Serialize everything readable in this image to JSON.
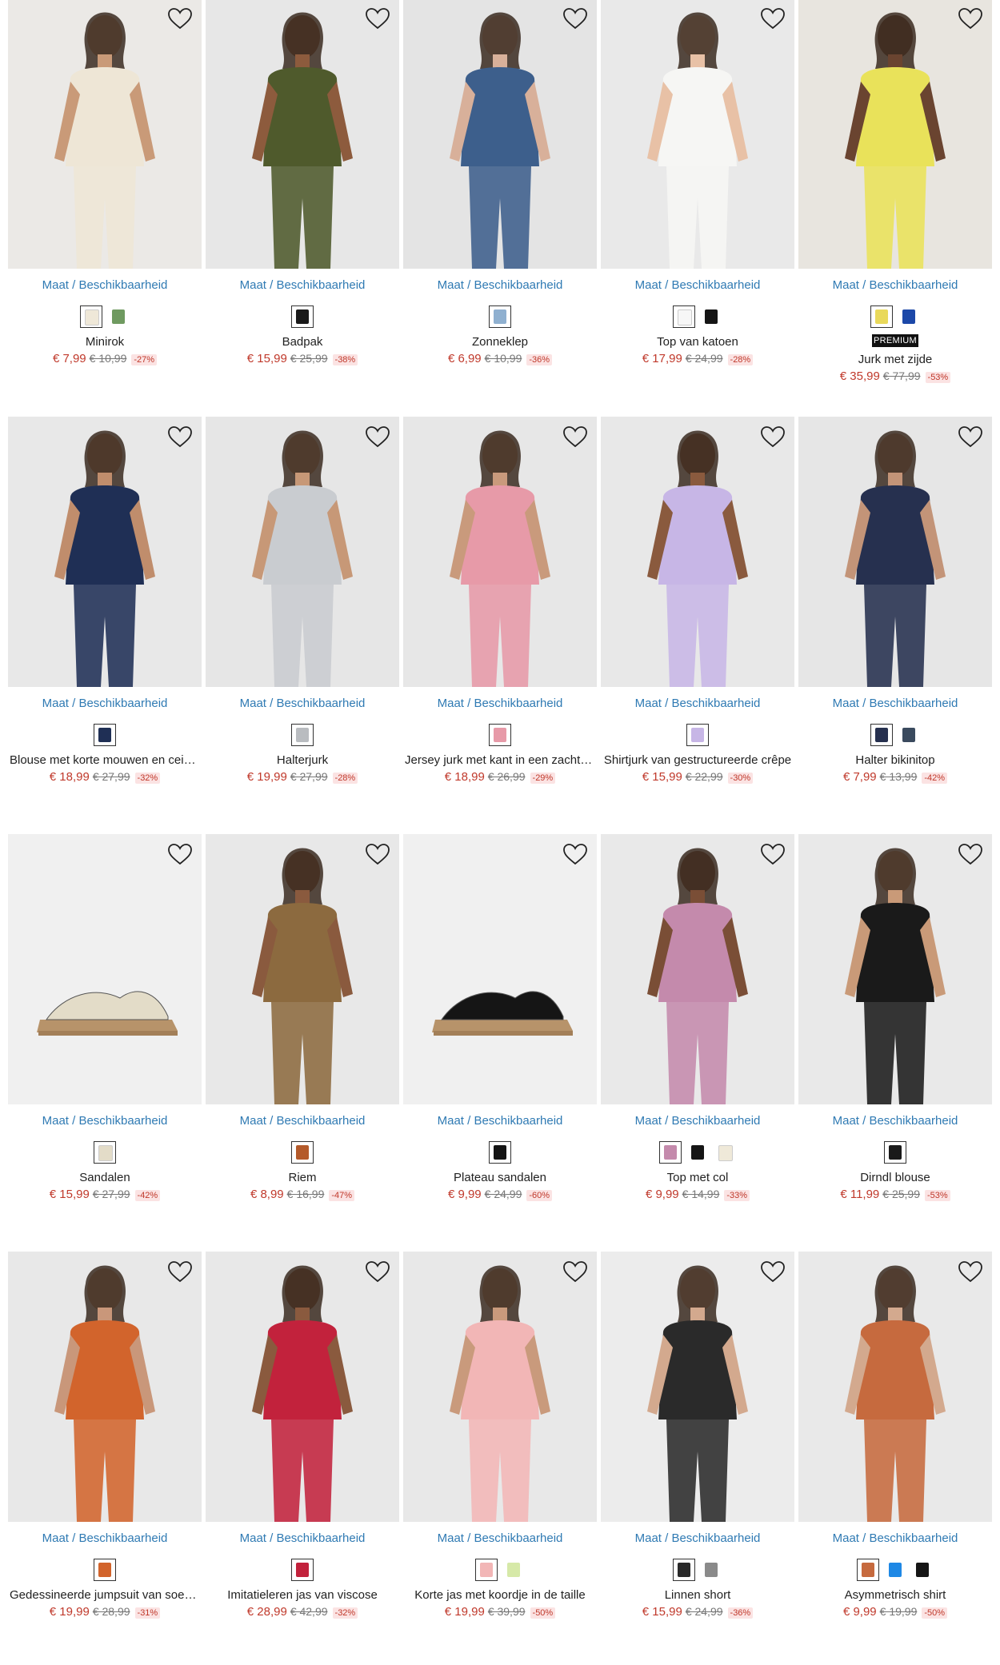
{
  "size_link_label": "Maat / Beschikbaarheid",
  "products": [
    {
      "name": "Minirok",
      "price": "€ 7,99",
      "old_price": "€ 10,99",
      "discount": "-27%",
      "bg": "#ebe9e6",
      "garment": "#eee6d6",
      "skin": "#c99a78",
      "swatches": [
        "#efe8d8",
        "#6f9a60"
      ],
      "premium": ""
    },
    {
      "name": "Badpak",
      "price": "€ 15,99",
      "old_price": "€ 25,99",
      "discount": "-38%",
      "bg": "#e7e7e7",
      "garment": "#4f5a2c",
      "skin": "#8d5b3d",
      "swatches": [
        "#1a1a1a"
      ],
      "premium": ""
    },
    {
      "name": "Zonneklep",
      "price": "€ 6,99",
      "old_price": "€ 10,99",
      "discount": "-36%",
      "bg": "#e4e4e4",
      "garment": "#3d5f8c",
      "skin": "#d8b09a",
      "swatches": [
        "#8fb0d0"
      ],
      "premium": ""
    },
    {
      "name": "Top van katoen",
      "price": "€ 17,99",
      "old_price": "€ 24,99",
      "discount": "-28%",
      "bg": "#e9e9e9",
      "garment": "#f6f6f4",
      "skin": "#e8c1a6",
      "swatches": [
        "#f7f7f7",
        "#151515"
      ],
      "premium": ""
    },
    {
      "name": "Jurk met zijde",
      "price": "€ 35,99",
      "old_price": "€ 77,99",
      "discount": "-53%",
      "bg": "#e8e5df",
      "garment": "#e9e25a",
      "skin": "#6a4430",
      "swatches": [
        "#e9d95a",
        "#1c48a8"
      ],
      "premium": "PREMIUM"
    },
    {
      "name": "Blouse met korte mouwen en ceintuur",
      "price": "€ 18,99",
      "old_price": "€ 27,99",
      "discount": "-32%",
      "bg": "#e8e8e8",
      "garment": "#1f2f55",
      "skin": "#c08d6c",
      "swatches": [
        "#1f2f55"
      ],
      "premium": ""
    },
    {
      "name": "Halterjurk",
      "price": "€ 19,99",
      "old_price": "€ 27,99",
      "discount": "-28%",
      "bg": "#e6e6e6",
      "garment": "#c9ccd0",
      "skin": "#c79877",
      "swatches": [
        "#b9bcc0"
      ],
      "premium": ""
    },
    {
      "name": "Jersey jurk met kant in een zacht viscose",
      "price": "€ 18,99",
      "old_price": "€ 26,99",
      "discount": "-29%",
      "bg": "#e7e7e7",
      "garment": "#e79aa8",
      "skin": "#c99a7c",
      "swatches": [
        "#e79aa8"
      ],
      "premium": ""
    },
    {
      "name": "Shirtjurk van gestructureerde crêpe",
      "price": "€ 15,99",
      "old_price": "€ 22,99",
      "discount": "-30%",
      "bg": "#e8e8e8",
      "garment": "#c7b6e6",
      "skin": "#8a5a3e",
      "swatches": [
        "#c7b6e6"
      ],
      "premium": ""
    },
    {
      "name": "Halter bikinitop",
      "price": "€ 7,99",
      "old_price": "€ 13,99",
      "discount": "-42%",
      "bg": "#e6e6e6",
      "garment": "#26304f",
      "skin": "#c39478",
      "swatches": [
        "#26304f",
        "#3a4a5e"
      ],
      "premium": ""
    },
    {
      "name": "Sandalen",
      "price": "€ 15,99",
      "old_price": "€ 27,99",
      "discount": "-42%",
      "bg": "#f0f0f0",
      "garment": "#e3dcc8",
      "skin": "",
      "swatches": [
        "#e3dcc8"
      ],
      "premium": ""
    },
    {
      "name": "Riem",
      "price": "€ 8,99",
      "old_price": "€ 16,99",
      "discount": "-47%",
      "bg": "#e8e8e8",
      "garment": "#8c6a3f",
      "skin": "#8a5a3e",
      "swatches": [
        "#b45a2a"
      ],
      "premium": ""
    },
    {
      "name": "Plateau sandalen",
      "price": "€ 9,99",
      "old_price": "€ 24,99",
      "discount": "-60%",
      "bg": "#f0f0f0",
      "garment": "#151515",
      "skin": "",
      "swatches": [
        "#151515"
      ],
      "premium": ""
    },
    {
      "name": "Top met col",
      "price": "€ 9,99",
      "old_price": "€ 14,99",
      "discount": "-33%",
      "bg": "#e9e9e9",
      "garment": "#c48aac",
      "skin": "#7a4e36",
      "swatches": [
        "#c48aac",
        "#151515",
        "#efe9d9"
      ],
      "premium": ""
    },
    {
      "name": "Dirndl blouse",
      "price": "€ 11,99",
      "old_price": "€ 25,99",
      "discount": "-53%",
      "bg": "#e9e9e9",
      "garment": "#1a1a1a",
      "skin": "#c99a78",
      "swatches": [
        "#1a1a1a"
      ],
      "premium": ""
    },
    {
      "name": "Gedessineerde jumpsuit van soepel materiaal",
      "price": "€ 19,99",
      "old_price": "€ 28,99",
      "discount": "-31%",
      "bg": "#e8e8e8",
      "garment": "#d2642c",
      "skin": "#c9977a",
      "swatches": [
        "#d2642c"
      ],
      "premium": ""
    },
    {
      "name": "Imitatieleren jas van viscose",
      "price": "€ 28,99",
      "old_price": "€ 42,99",
      "discount": "-32%",
      "bg": "#e8e8e8",
      "garment": "#c2223c",
      "skin": "#8a5a3e",
      "swatches": [
        "#c2223c"
      ],
      "premium": ""
    },
    {
      "name": "Korte jas met koordje in de taille",
      "price": "€ 19,99",
      "old_price": "€ 39,99",
      "discount": "-50%",
      "bg": "#e8e8e8",
      "garment": "#f2b6b6",
      "skin": "#c99a7c",
      "swatches": [
        "#f2b6b6",
        "#d6e9a8"
      ],
      "premium": ""
    },
    {
      "name": "Linnen short",
      "price": "€ 15,99",
      "old_price": "€ 24,99",
      "discount": "-36%",
      "bg": "#ececec",
      "garment": "#2a2a2a",
      "skin": "#d3a98e",
      "swatches": [
        "#2a2a2a",
        "#8a8a8a"
      ],
      "premium": ""
    },
    {
      "name": "Asymmetrisch shirt",
      "price": "€ 9,99",
      "old_price": "€ 19,99",
      "discount": "-50%",
      "bg": "#e9e9e9",
      "garment": "#c66a3e",
      "skin": "#d3a98e",
      "swatches": [
        "#c66a3e",
        "#1e88e5",
        "#151515"
      ],
      "premium": ""
    }
  ]
}
